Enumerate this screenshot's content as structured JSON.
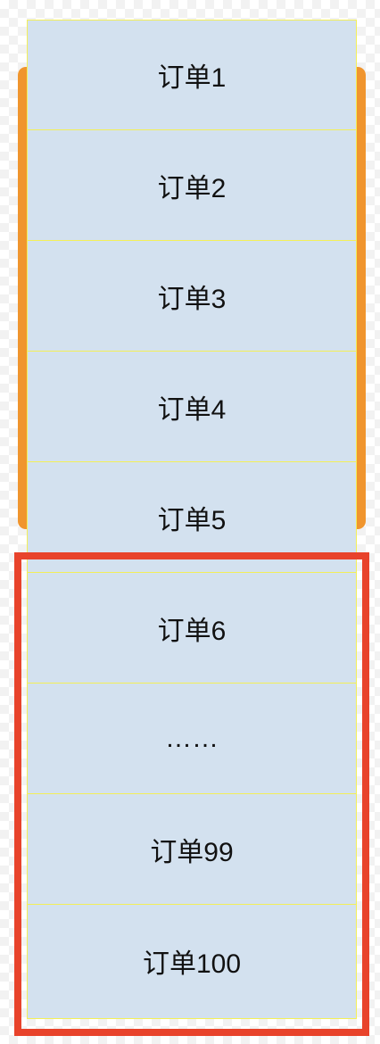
{
  "orders": [
    {
      "label": "订单1"
    },
    {
      "label": "订单2"
    },
    {
      "label": "订单3"
    },
    {
      "label": "订单4"
    },
    {
      "label": "订单5"
    },
    {
      "label": "订单6"
    },
    {
      "label": "……"
    },
    {
      "label": "订单99"
    },
    {
      "label": "订单100"
    }
  ],
  "colors": {
    "row_fill": "#d3e1ef",
    "row_border": "#f3ef58",
    "viewport_bracket": "#f0952e",
    "highlight_frame": "#e8432b"
  }
}
